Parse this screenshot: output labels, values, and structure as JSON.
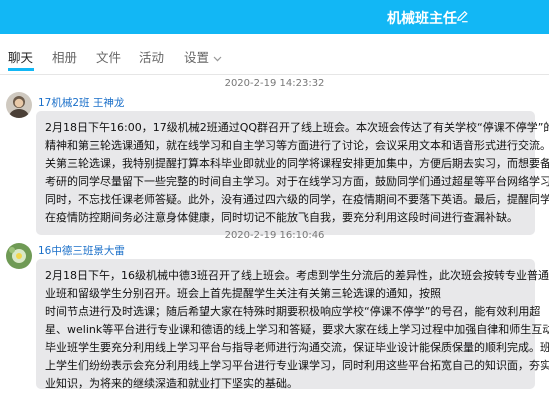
{
  "header": {
    "title": "机械班主任",
    "accent": "#12b7f5"
  },
  "tabs": [
    {
      "label": "聊天"
    },
    {
      "label": "相册"
    },
    {
      "label": "文件"
    },
    {
      "label": "活动"
    },
    {
      "label": "设置"
    }
  ],
  "messages": [
    {
      "time": "2020-2-19 14:23:32",
      "sender": "17机械2班 王神龙",
      "lines": [
        "2月18日下午16:00，17级机械2班通过QQ群召开了线上班会。本次班会传达了有关学校“停课不停学”的",
        "精神和第三轮选课通知，就在线学习和自主学习等方面进行了讨论，会议采用文本和语音形式进行交流。有",
        "关第三轮选课，我特别提醒打算本科毕业即就业的同学将课程安排更加集中，方便后期去实习，而想要备战",
        "考研的同学尽量留下一些完整的时间自主学习。对于在线学习方面，鼓励同学们通过超星等平台网络学习的",
        "同时，不忘找任课老师答疑。此外，没有通过四六级的同学，在疫情期间不要落下英语。最后，提醒同学们",
        "在疫情防控期间务必注意身体健康，同时切记不能放飞自我，要充分利用这段时间进行查漏补缺。"
      ]
    },
    {
      "time": "2020-2-19 16:10:46",
      "sender": "16中德三班景大雷",
      "lines": [
        "2月18日下午，16级机械中德3班召开了线上班会。考虑到学生分流后的差异性，此次班会按转专业普通毕",
        "业班和留级学生分别召开。班会上首先提醒学生关注有关第三轮选课的通知，按照",
        "时间节点进行及时选课；随后希望大家在特殊时期要积极响应学校“停课不停学”的号召，能有效利用超",
        "星、welink等平台进行专业课和德语的线上学习和答疑，要求大家在线上学习过程中加强自律和师生互动，",
        "毕业班学生要充分利用线上学习平台与指导老师进行沟通交流，保证毕业设计能保质保量的顺利完成。班会",
        "上学生们纷纷表示会充分利用线上学习平台进行专业课学习，同时利用这些平台拓宽自己的知识面，夯实专",
        "业知识，为将来的继续深造和就业打下坚实的基础。"
      ]
    }
  ]
}
